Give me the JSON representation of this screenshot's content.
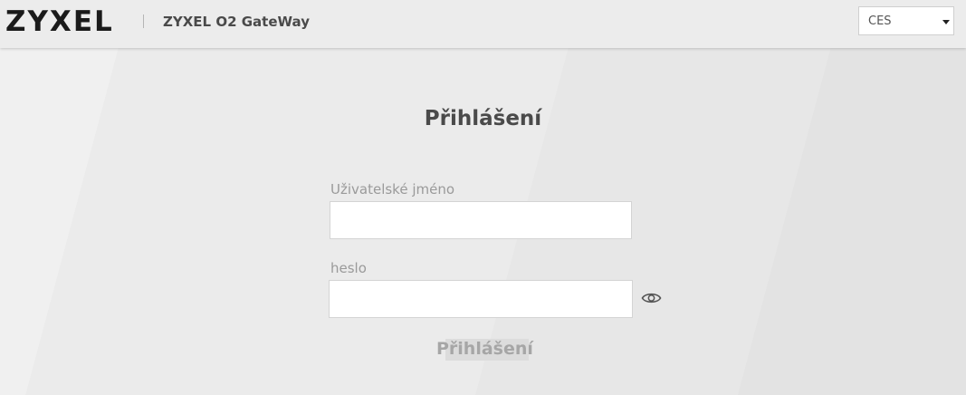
{
  "header": {
    "logo_text": "ZYXEL",
    "app_title": "ZYXEL O2 GateWay",
    "language": {
      "selected": "CES"
    }
  },
  "login": {
    "title": "Přihlášení",
    "username": {
      "label": "Uživatelské jméno",
      "value": "",
      "placeholder": ""
    },
    "password": {
      "label": "heslo",
      "value": "",
      "placeholder": ""
    },
    "submit_label": "Přihlášení"
  },
  "icons": {
    "show_password": "eye-icon",
    "language_dropdown": "chevron-down-icon"
  },
  "colors": {
    "header_bg": "#ececec",
    "page_bg": "#e9e9e9",
    "title_text": "#4a4a4a",
    "label_text": "#9a9a9a",
    "button_text": "#a6a6a6",
    "button_bg": "#dcdcdc"
  }
}
